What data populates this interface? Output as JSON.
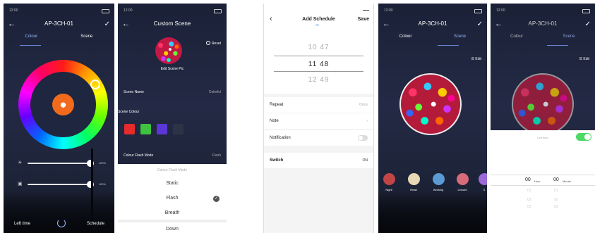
{
  "status_time": "12:00",
  "screen1": {
    "title": "AP-3CH-01",
    "tabs": [
      "Colour",
      "Scene"
    ],
    "brightness_value": "100%",
    "saturation_value": "100%",
    "left_button": "Left time",
    "right_button": "Schedule"
  },
  "screen2": {
    "title": "Custom Scene",
    "reset_label": "Reset",
    "edit_pic_label": "Edit Scene Pic",
    "scene_name_label": "Scene Name",
    "scene_name_value": "Colorful",
    "scene_colour_label": "Scene Colour",
    "swatches": [
      "#e62b2b",
      "#3fc23f",
      "#5a37d6",
      "#2c3346"
    ],
    "flash_mode_label": "Colour Flash Mode",
    "flash_mode_value": "Flash",
    "sheet_title": "Colour Flash Mode",
    "options": [
      "Static",
      "Flash",
      "Breath",
      "Down"
    ],
    "selected_option": "Flash"
  },
  "screen3": {
    "title": "Add Schedule",
    "save_label": "Save",
    "times": [
      "10 47",
      "11 48",
      "12 49"
    ],
    "selected_time": "11 48",
    "repeat_label": "Repeat",
    "repeat_value": "Once",
    "note_label": "Note",
    "notification_label": "Notification",
    "switch_label": "Switch",
    "switch_value": "ON"
  },
  "screen4": {
    "title": "AP-3CH-01",
    "tabs": [
      "Colour",
      "Scene"
    ],
    "edit_label": "Edit",
    "scenes": [
      {
        "name": "Night",
        "color": "#c24545"
      },
      {
        "name": "Read",
        "color": "#e8d9b5"
      },
      {
        "name": "Working",
        "color": "#5b9bd5"
      },
      {
        "name": "Leisure",
        "color": "#d86b7a"
      },
      {
        "name": "S",
        "color": "#9a6bd8"
      }
    ]
  },
  "screen5": {
    "title": "AP-3CH-01",
    "tabs": [
      "Colour",
      "Scene"
    ],
    "edit_label": "Edit",
    "left_time_label": "Left time",
    "hour_value": "00",
    "hour_unit": "Hour",
    "minute_value": "00",
    "minute_unit": "Minute",
    "below_values": [
      "01",
      "02",
      "03"
    ]
  },
  "colors": {
    "accent": "#6f86d8",
    "bulb": "#f26b1d",
    "toggle_on": "#4cd964"
  }
}
